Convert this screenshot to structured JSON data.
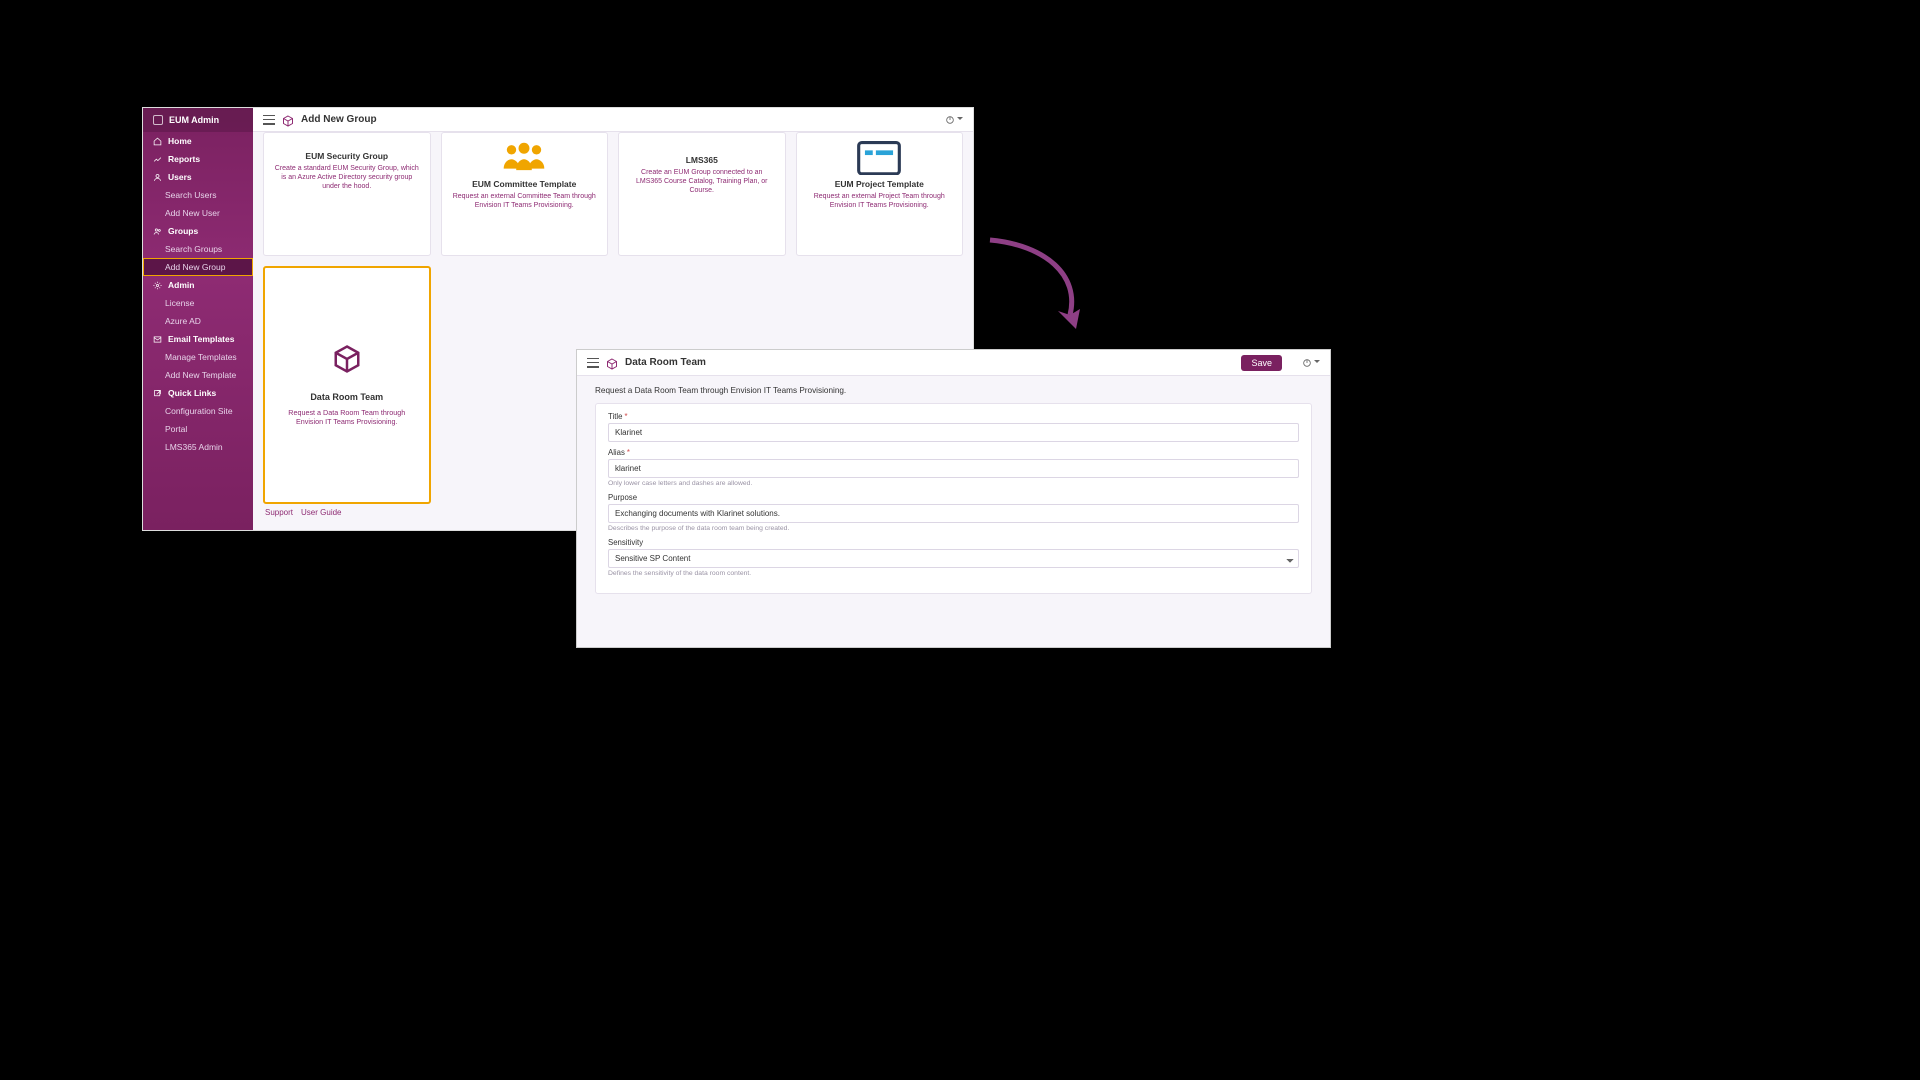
{
  "brand": "EUM Admin",
  "sidebar": {
    "items": [
      {
        "label": "Home",
        "kind": "head",
        "icon": "home"
      },
      {
        "label": "Reports",
        "kind": "head",
        "icon": "chart"
      },
      {
        "label": "Users",
        "kind": "head",
        "icon": "user"
      },
      {
        "label": "Search Users",
        "kind": "sub"
      },
      {
        "label": "Add New User",
        "kind": "sub"
      },
      {
        "label": "Groups",
        "kind": "head",
        "icon": "group"
      },
      {
        "label": "Search Groups",
        "kind": "sub"
      },
      {
        "label": "Add New Group",
        "kind": "sub",
        "active": true
      },
      {
        "label": "Admin",
        "kind": "head",
        "icon": "gear"
      },
      {
        "label": "License",
        "kind": "sub"
      },
      {
        "label": "Azure AD",
        "kind": "sub"
      },
      {
        "label": "Email Templates",
        "kind": "head",
        "icon": "mail"
      },
      {
        "label": "Manage Templates",
        "kind": "sub"
      },
      {
        "label": "Add New Template",
        "kind": "sub"
      },
      {
        "label": "Quick Links",
        "kind": "head",
        "icon": "link"
      },
      {
        "label": "Configuration Site",
        "kind": "sub"
      },
      {
        "label": "Portal",
        "kind": "sub"
      },
      {
        "label": "LMS365 Admin",
        "kind": "sub"
      }
    ]
  },
  "page1": {
    "title": "Add New Group",
    "footer": {
      "support": "Support",
      "guide": "User Guide"
    },
    "cards": [
      {
        "id": "security",
        "title": "EUM Security Group",
        "desc": "Create a standard EUM Security Group, which is an Azure Active Directory security group under the hood."
      },
      {
        "id": "committee",
        "title": "EUM Committee Template",
        "desc": "Request an external Committee Team through Envision IT Teams Provisioning."
      },
      {
        "id": "lms",
        "title": "LMS365",
        "desc": "Create an EUM Group connected to an LMS365 Course Catalog, Training Plan, or Course."
      },
      {
        "id": "project",
        "title": "EUM Project Template",
        "desc": "Request an external Project Team through Envision IT Teams Provisioning."
      }
    ],
    "selected": {
      "title": "Data Room Team",
      "desc": "Request a Data Room Team through Envision IT Teams Provisioning."
    }
  },
  "page2": {
    "title": "Data Room Team",
    "save": "Save",
    "intro": "Request a Data Room Team through Envision IT Teams Provisioning.",
    "fields": {
      "title": {
        "label": "Title",
        "value": "Klarinet"
      },
      "alias": {
        "label": "Alias",
        "value": "klarinet",
        "help": "Only lower case letters and dashes are allowed."
      },
      "purpose": {
        "label": "Purpose",
        "value": "Exchanging documents with Klarinet solutions.",
        "help": "Describes the purpose of the data room team being created."
      },
      "sensitivity": {
        "label": "Sensitivity",
        "value": "Sensitive SP Content",
        "help": "Defines the sensitivity of the data room content."
      }
    }
  }
}
